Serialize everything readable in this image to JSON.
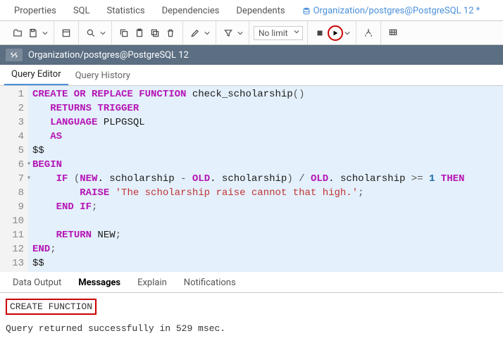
{
  "topTabs": {
    "properties": "Properties",
    "sql": "SQL",
    "statistics": "Statistics",
    "dependencies": "Dependencies",
    "dependents": "Dependents",
    "active": "Organization/postgres@PostgreSQL 12 *"
  },
  "toolbar": {
    "limit": "No limit"
  },
  "connection": {
    "label": "Organization/postgres@PostgreSQL 12"
  },
  "editorTabs": {
    "queryEditor": "Query Editor",
    "queryHistory": "Query History"
  },
  "code": {
    "lines": [
      {
        "n": "1",
        "frag": [
          [
            "kw",
            "CREATE OR REPLACE FUNCTION"
          ],
          [
            "fn",
            " check_scholarship"
          ],
          [
            "pn",
            "()"
          ]
        ]
      },
      {
        "n": "2",
        "frag": [
          [
            "pn",
            "   "
          ],
          [
            "kw",
            "RETURNS TRIGGER"
          ]
        ]
      },
      {
        "n": "3",
        "frag": [
          [
            "pn",
            "   "
          ],
          [
            "kw",
            "LANGUAGE"
          ],
          [
            "fn",
            " PLPGSQL"
          ]
        ]
      },
      {
        "n": "4",
        "frag": [
          [
            "pn",
            "   "
          ],
          [
            "kw",
            "AS"
          ]
        ]
      },
      {
        "n": "5",
        "frag": [
          [
            "fn",
            "$$"
          ]
        ]
      },
      {
        "n": "6",
        "fold": true,
        "frag": [
          [
            "kw",
            "BEGIN"
          ]
        ]
      },
      {
        "n": "7",
        "fold": true,
        "frag": [
          [
            "pn",
            "    "
          ],
          [
            "kw",
            "IF"
          ],
          [
            "pn",
            " ("
          ],
          [
            "kw",
            "NEW"
          ],
          [
            "fn",
            ". scholarship "
          ],
          [
            "pn",
            "- "
          ],
          [
            "kw",
            "OLD"
          ],
          [
            "fn",
            ". scholarship"
          ],
          [
            "pn",
            ") / "
          ],
          [
            "kw",
            "OLD"
          ],
          [
            "fn",
            ". scholarship "
          ],
          [
            "pn",
            ">= "
          ],
          [
            "num",
            "1"
          ],
          [
            "kw",
            " THEN"
          ]
        ]
      },
      {
        "n": "8",
        "frag": [
          [
            "pn",
            "        "
          ],
          [
            "kw",
            "RAISE"
          ],
          [
            "pn",
            " "
          ],
          [
            "str",
            "'The scholarship raise cannot that high.'"
          ],
          [
            "pn",
            ";"
          ]
        ]
      },
      {
        "n": "9",
        "frag": [
          [
            "pn",
            "    "
          ],
          [
            "kw",
            "END IF"
          ],
          [
            "pn",
            ";"
          ]
        ]
      },
      {
        "n": "10",
        "frag": [
          [
            "pn",
            ""
          ]
        ]
      },
      {
        "n": "11",
        "frag": [
          [
            "pn",
            "    "
          ],
          [
            "kw",
            "RETURN"
          ],
          [
            "fn",
            " NEW"
          ],
          [
            "pn",
            ";"
          ]
        ]
      },
      {
        "n": "12",
        "frag": [
          [
            "kw",
            "END"
          ],
          [
            "pn",
            ";"
          ]
        ]
      },
      {
        "n": "13",
        "frag": [
          [
            "fn",
            "$$"
          ]
        ]
      }
    ]
  },
  "outputTabs": {
    "dataOutput": "Data Output",
    "messages": "Messages",
    "explain": "Explain",
    "notifications": "Notifications"
  },
  "messages": {
    "result": "CREATE FUNCTION",
    "status": "Query returned successfully in 529 msec."
  }
}
